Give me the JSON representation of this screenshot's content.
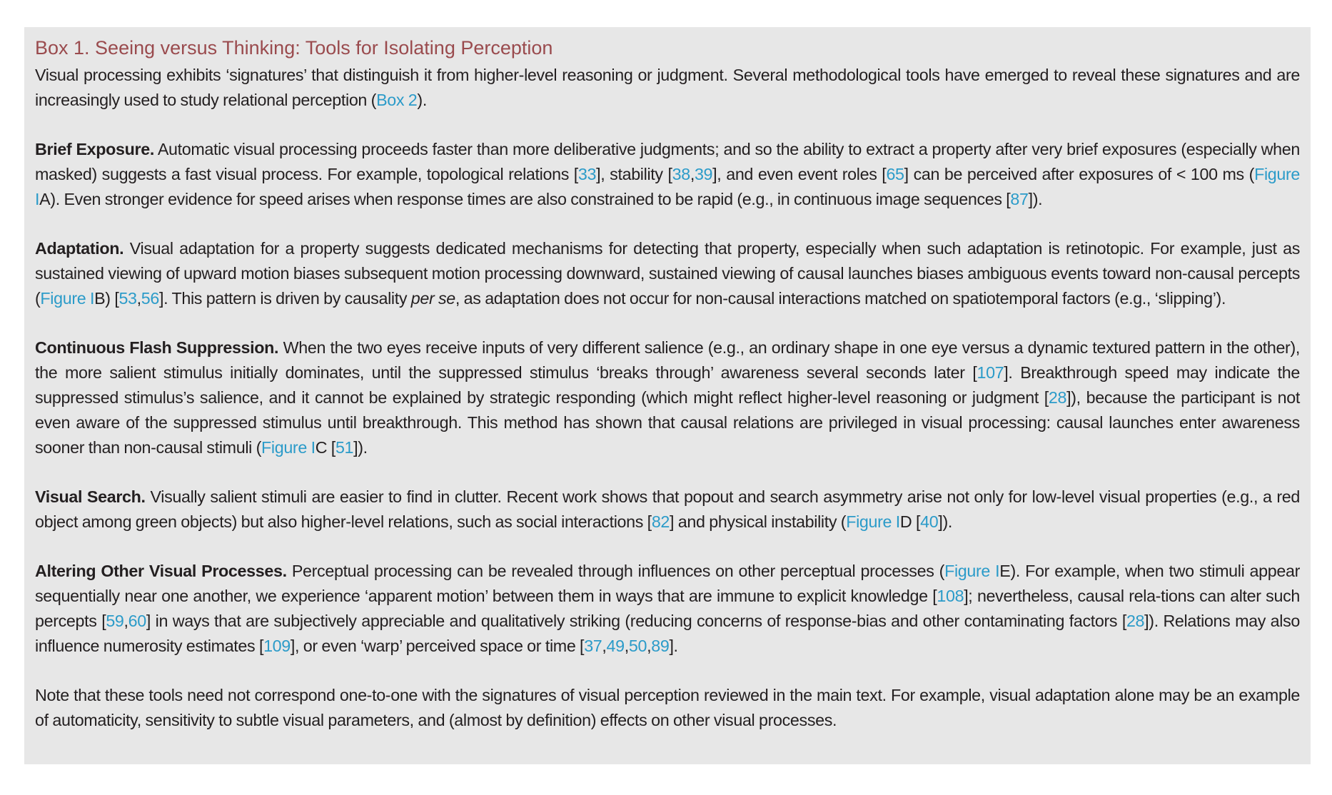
{
  "box": {
    "title": "Box 1. Seeing versus Thinking: Tools for Isolating Perception"
  },
  "colors": {
    "title": "#9a4b4e",
    "link": "#2b9bc9",
    "box_background": "#e7e7e7",
    "text": "#231f20"
  },
  "paragraphs": [
    {
      "id": "intro",
      "segments": [
        {
          "t": "text",
          "v": "Visual processing exhibits ‘signatures’ that distinguish it from higher-level reasoning or judgment. Several methodological tools have emerged to reveal these signatures and are increasingly used to study relational perception ("
        },
        {
          "t": "link",
          "v": "Box 2"
        },
        {
          "t": "text",
          "v": ")."
        }
      ]
    },
    {
      "id": "brief-exposure",
      "segments": [
        {
          "t": "heading",
          "v": "Brief Exposure."
        },
        {
          "t": "text",
          "v": " Automatic visual processing proceeds faster than more deliberative judgments; and so the ability to extract a property after very brief exposures (especially when masked) suggests a fast visual process. For example, topological relations ["
        },
        {
          "t": "link",
          "v": "33"
        },
        {
          "t": "text",
          "v": "], stability ["
        },
        {
          "t": "link",
          "v": "38"
        },
        {
          "t": "text",
          "v": ","
        },
        {
          "t": "link",
          "v": "39"
        },
        {
          "t": "text",
          "v": "], and even event roles ["
        },
        {
          "t": "link",
          "v": "65"
        },
        {
          "t": "text",
          "v": "] can be perceived after exposures of < 100 ms ("
        },
        {
          "t": "link",
          "v": "Figure I"
        },
        {
          "t": "text",
          "v": "A). Even stronger evidence for speed arises when response times are also constrained to be rapid (e.g., in continuous image sequences ["
        },
        {
          "t": "link",
          "v": "87"
        },
        {
          "t": "text",
          "v": "])."
        }
      ]
    },
    {
      "id": "adaptation",
      "segments": [
        {
          "t": "heading",
          "v": "Adaptation."
        },
        {
          "t": "text",
          "v": " Visual adaptation for a property suggests dedicated mechanisms for detecting that property, especially when such adaptation is retinotopic. For example, just as sustained viewing of upward motion biases subsequent motion processing downward, sustained viewing of causal launches biases ambiguous events toward non-causal percepts ("
        },
        {
          "t": "link",
          "v": "Figure I"
        },
        {
          "t": "text",
          "v": "B) ["
        },
        {
          "t": "link",
          "v": "53"
        },
        {
          "t": "text",
          "v": ","
        },
        {
          "t": "link",
          "v": "56"
        },
        {
          "t": "text",
          "v": "]. This pattern is driven by causality "
        },
        {
          "t": "italic",
          "v": "per se"
        },
        {
          "t": "text",
          "v": ", as adaptation does not occur for non-causal interactions matched on spatiotemporal factors (e.g., ‘slipping’)."
        }
      ]
    },
    {
      "id": "cfs",
      "segments": [
        {
          "t": "heading",
          "v": "Continuous Flash Suppression."
        },
        {
          "t": "text",
          "v": " When the two eyes receive inputs of very different salience (e.g., an ordinary shape in one eye versus a dynamic textured pattern in the other), the more salient stimulus initially dominates, until the suppressed stimulus ‘breaks through’ awareness several seconds later ["
        },
        {
          "t": "link",
          "v": "107"
        },
        {
          "t": "text",
          "v": "]. Breakthrough speed may indicate the suppressed stimulus’s salience, and it cannot be explained by strategic responding (which might reflect higher-level reasoning or judgment ["
        },
        {
          "t": "link",
          "v": "28"
        },
        {
          "t": "text",
          "v": "]), because the participant is not even aware of the suppressed stimulus until breakthrough. This method has shown that causal relations are privileged in visual processing: causal launches enter awareness sooner than non-causal stimuli ("
        },
        {
          "t": "link",
          "v": "Figure I"
        },
        {
          "t": "text",
          "v": "C ["
        },
        {
          "t": "link",
          "v": "51"
        },
        {
          "t": "text",
          "v": "])."
        }
      ]
    },
    {
      "id": "visual-search",
      "segments": [
        {
          "t": "heading",
          "v": "Visual Search."
        },
        {
          "t": "text",
          "v": " Visually salient stimuli are easier to find in clutter. Recent work shows that popout and search asymmetry arise not only for low-level visual properties (e.g., a red object among green objects) but also higher-level relations, such as social interactions ["
        },
        {
          "t": "link",
          "v": "82"
        },
        {
          "t": "text",
          "v": "] and physical instability ("
        },
        {
          "t": "link",
          "v": "Figure I"
        },
        {
          "t": "text",
          "v": "D ["
        },
        {
          "t": "link",
          "v": "40"
        },
        {
          "t": "text",
          "v": "])."
        }
      ]
    },
    {
      "id": "altering",
      "segments": [
        {
          "t": "heading",
          "v": "Altering Other Visual Processes."
        },
        {
          "t": "text",
          "v": " Perceptual processing can be revealed through influences on other perceptual processes ("
        },
        {
          "t": "link",
          "v": "Figure I"
        },
        {
          "t": "text",
          "v": "E). For example, when two stimuli appear sequentially near one another, we experience ‘apparent motion’ between them in ways that are immune to explicit knowledge ["
        },
        {
          "t": "link",
          "v": "108"
        },
        {
          "t": "text",
          "v": "]; nevertheless, causal rela-tions can alter such percepts ["
        },
        {
          "t": "link",
          "v": "59"
        },
        {
          "t": "text",
          "v": ","
        },
        {
          "t": "link",
          "v": "60"
        },
        {
          "t": "text",
          "v": "] in ways that are subjectively appreciable and qualitatively striking (reducing concerns of response-bias and other contaminating factors ["
        },
        {
          "t": "link",
          "v": "28"
        },
        {
          "t": "text",
          "v": "]). Relations may also influence numerosity estimates ["
        },
        {
          "t": "link",
          "v": "109"
        },
        {
          "t": "text",
          "v": "], or even ‘warp’ perceived space or time ["
        },
        {
          "t": "link",
          "v": "37"
        },
        {
          "t": "text",
          "v": ","
        },
        {
          "t": "link",
          "v": "49"
        },
        {
          "t": "text",
          "v": ","
        },
        {
          "t": "link",
          "v": "50"
        },
        {
          "t": "text",
          "v": ","
        },
        {
          "t": "link",
          "v": "89"
        },
        {
          "t": "text",
          "v": "]."
        }
      ]
    },
    {
      "id": "note",
      "segments": [
        {
          "t": "text",
          "v": "Note that these tools need not correspond one-to-one with the signatures of visual perception reviewed in the main text. For example, visual adaptation alone may be an example of automaticity, sensitivity to subtle visual parameters, and (almost by definition) effects on other visual processes."
        }
      ]
    }
  ]
}
